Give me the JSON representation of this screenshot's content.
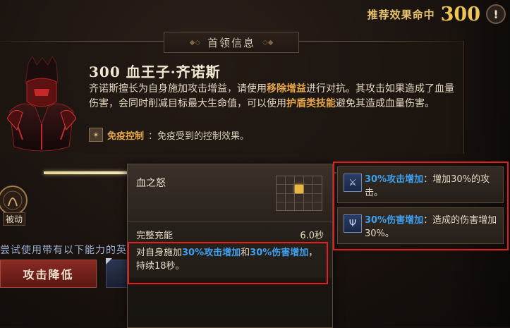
{
  "recommended": {
    "label": "推荐效果命中",
    "value": "300",
    "alert": "!"
  },
  "header": {
    "title": "首领信息"
  },
  "boss": {
    "name": "300 血王子·齐诺斯",
    "desc_1": "齐诺斯擅长为自身施加攻击增益，请使用",
    "desc_hl1": "移除增益",
    "desc_2": "进行对抗。其攻击如果造成了血量伤害，会同时削减目标最大生命值，可以使用",
    "desc_hl2": "护盾类技能",
    "desc_3": "避免其造成血量伤害。",
    "immune_title": "免疫控制",
    "immune_text": "：免疫受到的控制效果。"
  },
  "passive": {
    "label": "被动"
  },
  "hint": "尝试使用带有以下能力的英",
  "attack_button": "攻击降低",
  "tooltip": {
    "title": "血之怒",
    "charge_label": "完整充能",
    "charge_value": "6.0秒",
    "desc_1": "对自身施加",
    "desc_hl1": "30%攻击增加",
    "desc_2": "和",
    "desc_hl2": "30%伤害增加",
    "desc_3": "，持续18秒。"
  },
  "buffs": [
    {
      "icon": "sword-icon",
      "name": "30%攻击增加",
      "text": "：增加30%的攻击。"
    },
    {
      "icon": "trident-icon",
      "name": "30%伤害增加",
      "text": "：造成的伤害增加30%。"
    }
  ],
  "colors": {
    "accent_gold": "#e3a548",
    "highlight_blue": "#3ea0f0",
    "annotation_red": "#e02020"
  }
}
